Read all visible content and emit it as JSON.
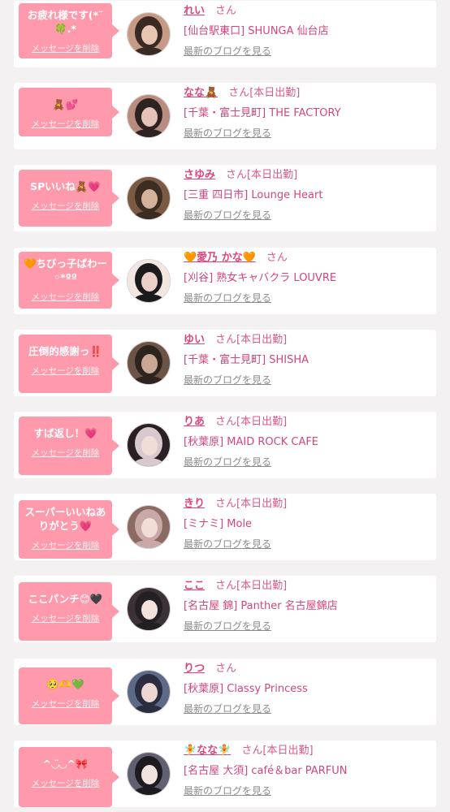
{
  "ui": {
    "san": "さん",
    "on_duty": "[本日出勤]",
    "delete_label": "メッセージを削除",
    "blog_link": "最新のブログを見る"
  },
  "colors": {
    "background": "#f4f1f2",
    "bubble": "#ff9aad",
    "name": "#e0457e",
    "shop": "#d1467e",
    "blog_link": "#8c8c8c"
  },
  "messages": [
    {
      "text": "お疲れ様です(*¨\n🍀.*",
      "name": "れい",
      "on_duty": false,
      "shop": "[仙台駅東口] SHUNGA 仙台店",
      "avatar_icon": "avatar-photo"
    },
    {
      "text": "🧸💕",
      "name": "なな🧸",
      "on_duty": true,
      "shop": "[千葉・富士見町] THE FACTORY",
      "avatar_icon": "avatar-photo"
    },
    {
      "text": "SPいいね🧸💗",
      "name": "さゆみ",
      "on_duty": true,
      "shop": "[三重 四日市] Lounge Heart",
      "avatar_icon": "avatar-photo"
    },
    {
      "text": "🧡ちびっ子ぱわー\n◦*ºº",
      "name": "🧡愛乃 かな🧡",
      "on_duty": false,
      "shop": "[刈谷] 熟女キャバクラ LOUVRE",
      "avatar_icon": "avatar-photo"
    },
    {
      "text": "圧倒的感謝っ‼️",
      "name": "ゆい",
      "on_duty": true,
      "shop": "[千葉・富士見町] SHISHA",
      "avatar_icon": "avatar-photo"
    },
    {
      "text": "すば返し！💗",
      "name": "りあ",
      "on_duty": true,
      "shop": "[秋葉原] MAID ROCK CAFE",
      "avatar_icon": "avatar-photo"
    },
    {
      "text": "スーパーいいねあ\nりがとう💗",
      "name": "きり",
      "on_duty": true,
      "shop": "[ミナミ] Mole",
      "avatar_icon": "avatar-photo"
    },
    {
      "text": "ここパンチ😊🖤",
      "name": "ここ",
      "on_duty": true,
      "shop": "[名古屋 錦] Panther 名古屋錦店",
      "avatar_icon": "avatar-photo"
    },
    {
      "text": "🥺🫶💚",
      "name": "りつ",
      "on_duty": false,
      "shop": "[秋葉原] Classy Princess",
      "avatar_icon": "avatar-photo"
    },
    {
      "text": "^◡︎̈◡︎^🎀",
      "name": "🧚なな🧚",
      "on_duty": true,
      "shop": "[名古屋 大須] café＆bar PARFUN",
      "avatar_icon": "avatar-photo"
    }
  ]
}
